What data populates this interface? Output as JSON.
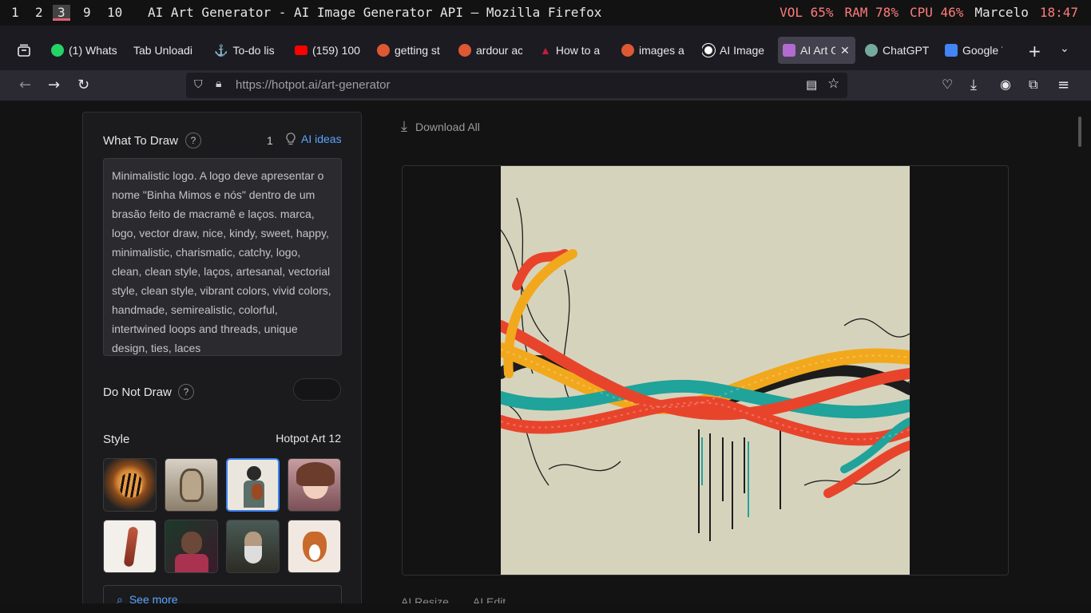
{
  "wm": {
    "workspaces": [
      "1",
      "2",
      "3",
      "9",
      "10"
    ],
    "active_workspace": "3",
    "window_title": "AI Art Generator - AI Image Generator API — Mozilla Firefox",
    "vol": "VOL 65%",
    "ram": "RAM 78%",
    "cpu": "CPU 46%",
    "user": "Marcelo",
    "time": "18:47"
  },
  "tabs": [
    {
      "label": "(1) Whats",
      "icon_color": "#25d366",
      "icon": "whatsapp-icon"
    },
    {
      "label": "Tab Unloadi",
      "icon_color": "",
      "icon": ""
    },
    {
      "label": "To-do lis",
      "icon_color": "#9e9ea6",
      "icon": "anchor-icon"
    },
    {
      "label": "(159) 100",
      "icon_color": "#ff0000",
      "icon": "youtube-icon"
    },
    {
      "label": "getting st",
      "icon_color": "#de5833",
      "icon": "duckduckgo-icon"
    },
    {
      "label": "ardour ac",
      "icon_color": "#de5833",
      "icon": "duckduckgo-icon"
    },
    {
      "label": "How to a",
      "icon_color": "#c41e3a",
      "icon": "arch-icon"
    },
    {
      "label": "images a",
      "icon_color": "#de5833",
      "icon": "duckduckgo-icon"
    },
    {
      "label": "AI Image",
      "icon_color": "#ffffff",
      "icon": "openai-icon"
    },
    {
      "label": "AI Art G",
      "icon_color": "#b36bd3",
      "icon": "hotpot-icon",
      "active": true
    },
    {
      "label": "ChatGPT",
      "icon_color": "#74aa9c",
      "icon": "chatgpt-icon"
    },
    {
      "label": "Google T",
      "icon_color": "#4285f4",
      "icon": "google-translate-icon"
    }
  ],
  "nav": {
    "url_host": "https://hotpot.ai",
    "url_path": "/art-generator"
  },
  "panel": {
    "what_to_draw": "What To Draw",
    "help": "?",
    "count": "1",
    "ai_ideas": "AI ideas",
    "prompt": "Minimalistic logo. A logo deve apresentar o nome \"Binha Mimos e nós\" dentro de um brasão feito de macramê e laços. marca, logo, vector draw, nice, kindy, sweet, happy, minimalistic, charismatic, catchy, logo, clean, clean style, laços, artesanal, vectorial style, clean style, vibrant colors, vivid colors, handmade, semirealistic, colorful, intertwined loops and threads, unique design, ties, laces",
    "do_not_draw": "Do Not Draw",
    "style_label": "Style",
    "style_name": "Hotpot Art 12",
    "see_more": "See more",
    "thumbs": [
      "tiger",
      "robot-bull",
      "violinist",
      "anime-girl",
      "mannequin",
      "warrior",
      "old-man",
      "fox-logo"
    ]
  },
  "main": {
    "download_all": "Download All",
    "tools": [
      "AI Resize",
      "AI Edit"
    ]
  },
  "colors": {
    "accent": "#58a6ff",
    "selected_border": "#3b82f6",
    "rope_red": "#e8442c",
    "rope_orange": "#f2a81c",
    "rope_teal": "#1fa39a",
    "rope_black": "#1c1c1c"
  }
}
